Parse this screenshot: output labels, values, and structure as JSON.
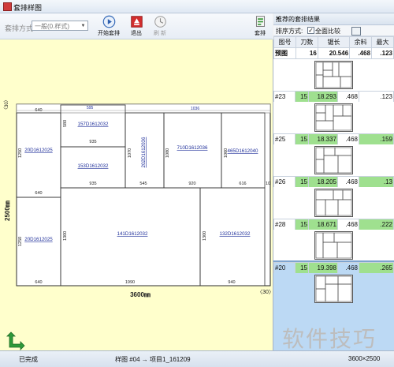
{
  "window": {
    "title": "套排样图"
  },
  "toolbar": {
    "mode_label": "套排方式:",
    "mode_value": "一般(0.样式)",
    "buttons": [
      {
        "label": "开始套排"
      },
      {
        "label": "退出"
      },
      {
        "label": "刷 新"
      }
    ],
    "settings_label": "套排"
  },
  "canvas": {
    "sheet_width_label": "3600㎜",
    "sheet_height_label": "2500㎜",
    "corner_label_br": "〈30〉",
    "corner_label_tl": "〈30〉",
    "parts": [
      {
        "name": "157D1612032",
        "dims": [
          "935",
          "580"
        ]
      },
      {
        "name": "153D1612032",
        "dims": [
          "935"
        ]
      },
      {
        "name": "202D1612036",
        "dims": [
          "1070"
        ]
      },
      {
        "name": "710D1612036",
        "dims": [
          "1080",
          "920"
        ]
      },
      {
        "name": "465D1612040",
        "dims": [
          "1060",
          "616"
        ]
      },
      {
        "name": "20D1612025",
        "dims": [
          "1250",
          "640"
        ]
      },
      {
        "name": "20D1612025",
        "dims": [
          "1250",
          "640"
        ]
      },
      {
        "name": "141D1612032",
        "dims": [
          "1300",
          "1990"
        ]
      },
      {
        "name": "132D1612032",
        "dims": [
          "1300",
          "940"
        ]
      }
    ],
    "edge_labels": [
      "640",
      "935",
      "935",
      "545",
      "920",
      "616",
      "10"
    ],
    "bottom_labels": [
      "640",
      "1990",
      "940"
    ]
  },
  "panel": {
    "title": "推荐的套排结果",
    "sort_label": "排序方式:",
    "sort_option": "全面比较",
    "columns": [
      "图号",
      "刀数",
      "锯长",
      "余料",
      "最大"
    ],
    "rows": [
      {
        "id": "预图",
        "knife": "16",
        "length": "20.546",
        "waste": ".468",
        "max": ".123"
      },
      {
        "id": "#23",
        "knife": "15",
        "length": "18.293",
        "waste": ".468",
        "max": ".123"
      },
      {
        "id": "#25",
        "knife": "15",
        "length": "18.337",
        "waste": ".468",
        "max": ".159"
      },
      {
        "id": "#26",
        "knife": "15",
        "length": "18.205",
        "waste": ".468",
        "max": ".13"
      },
      {
        "id": "#28",
        "knife": "15",
        "length": "18.671",
        "waste": ".468",
        "max": ".222"
      },
      {
        "id": "#20",
        "knife": "15",
        "length": "19.398",
        "waste": ".468",
        "max": ".265"
      }
    ]
  },
  "statusbar": {
    "left": "已完成",
    "mid": "样图 #04 → 项目1_161209",
    "right": "3600×2500"
  },
  "watermark": "软件技巧",
  "colors": {
    "canvas_bg": "#ffffcc",
    "selected_row": "#bcd9f4",
    "highlight": "#9fe08f",
    "part_line": "#303030",
    "label_blue": "#1f2f9a"
  }
}
